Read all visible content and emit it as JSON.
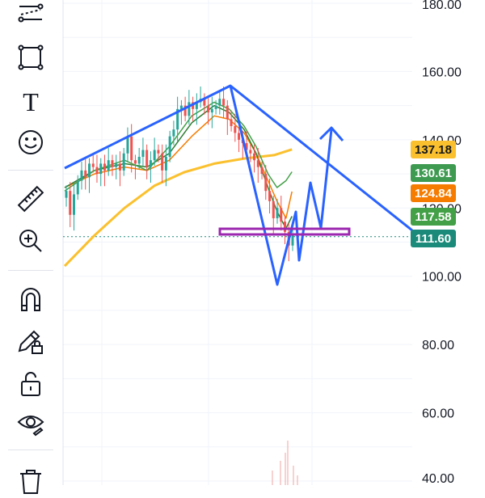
{
  "toolbar": {
    "tools": [
      {
        "name": "trend-lines-tool"
      },
      {
        "name": "shapes-tool"
      },
      {
        "name": "text-tool"
      },
      {
        "name": "icons-tool"
      },
      {
        "name": "measure-tool"
      },
      {
        "name": "zoom-in-tool"
      },
      {
        "name": "magnet-tool"
      },
      {
        "name": "lock-drawings-tool"
      },
      {
        "name": "lock-all-tool"
      },
      {
        "name": "hide-drawings-tool"
      },
      {
        "name": "remove-drawings-tool"
      }
    ],
    "text_tool_glyph": "T"
  },
  "chart_data": {
    "type": "line",
    "title": "",
    "xlabel": "",
    "ylabel": "",
    "ylim": [
      40,
      180
    ],
    "y_ticks": [
      "180.00",
      "160.00",
      "140.00",
      "120.00",
      "100.00",
      "80.00",
      "60.00",
      "40.00"
    ],
    "grid": true,
    "price_tags": [
      {
        "label": "137.18",
        "value": 137.18,
        "color": "#fbc02d",
        "text_color": "#131722"
      },
      {
        "label": "130.61",
        "value": 130.61,
        "color": "#3d9a50",
        "text_color": "#ffffff"
      },
      {
        "label": "124.84",
        "value": 124.84,
        "color": "#f57c00",
        "text_color": "#ffffff"
      },
      {
        "label": "117.58",
        "value": 117.58,
        "color": "#43a047",
        "text_color": "#ffffff"
      },
      {
        "label": "111.60",
        "value": 111.6,
        "color": "#1b8a7a",
        "text_color": "#ffffff"
      }
    ],
    "last_price": 111.6,
    "candle_colors": {
      "up": "#26a69a",
      "down": "#ef5350"
    },
    "candles_close": [
      125,
      118,
      124,
      128,
      131,
      129,
      133,
      132,
      130,
      133,
      131,
      134,
      132,
      133,
      131,
      136,
      141,
      134,
      133,
      135,
      137,
      132,
      134,
      137,
      136,
      131,
      135,
      141,
      143,
      149,
      150,
      147,
      151,
      149,
      151,
      152,
      150,
      148,
      149,
      150,
      152,
      150,
      146,
      144,
      142,
      140,
      139,
      137,
      136,
      134,
      132,
      130,
      125,
      122,
      117,
      120,
      116,
      113,
      109,
      112
    ],
    "moving_averages": [
      {
        "color": "#fbc02d",
        "values": [
          [
            0,
            103
          ],
          [
            20,
            112
          ],
          [
            40,
            120
          ],
          [
            60,
            126.5
          ],
          [
            80,
            130.5
          ],
          [
            100,
            133
          ],
          [
            120,
            134.5
          ],
          [
            140,
            135.5
          ],
          [
            152,
            137.18
          ]
        ]
      },
      {
        "color": "#f57c00",
        "values": [
          [
            0,
            126
          ],
          [
            20,
            130
          ],
          [
            40,
            132
          ],
          [
            55,
            131
          ],
          [
            70,
            134
          ],
          [
            85,
            141
          ],
          [
            100,
            147
          ],
          [
            110,
            146
          ],
          [
            120,
            142
          ],
          [
            128,
            136
          ],
          [
            136,
            128
          ],
          [
            142,
            122
          ],
          [
            148,
            117
          ],
          [
            152,
            124.84
          ]
        ]
      },
      {
        "color": "#2e7d32",
        "values": [
          [
            0,
            126
          ],
          [
            20,
            131
          ],
          [
            40,
            133
          ],
          [
            55,
            132
          ],
          [
            70,
            136
          ],
          [
            85,
            145
          ],
          [
            100,
            150
          ],
          [
            110,
            148
          ],
          [
            120,
            143
          ],
          [
            128,
            136
          ],
          [
            136,
            126
          ],
          [
            142,
            119
          ],
          [
            148,
            114
          ],
          [
            152,
            117.58
          ]
        ]
      },
      {
        "color": "#43a047",
        "values": [
          [
            0,
            125
          ],
          [
            20,
            131
          ],
          [
            40,
            134
          ],
          [
            55,
            131
          ],
          [
            70,
            138
          ],
          [
            85,
            147
          ],
          [
            100,
            151
          ],
          [
            110,
            149
          ],
          [
            120,
            144
          ],
          [
            128,
            138
          ],
          [
            136,
            130
          ],
          [
            142,
            126
          ],
          [
            148,
            128
          ],
          [
            152,
            130.61
          ]
        ]
      }
    ],
    "annotations": {
      "trendline_color": "#2962ff",
      "zone_color": "#9c27b0"
    }
  }
}
